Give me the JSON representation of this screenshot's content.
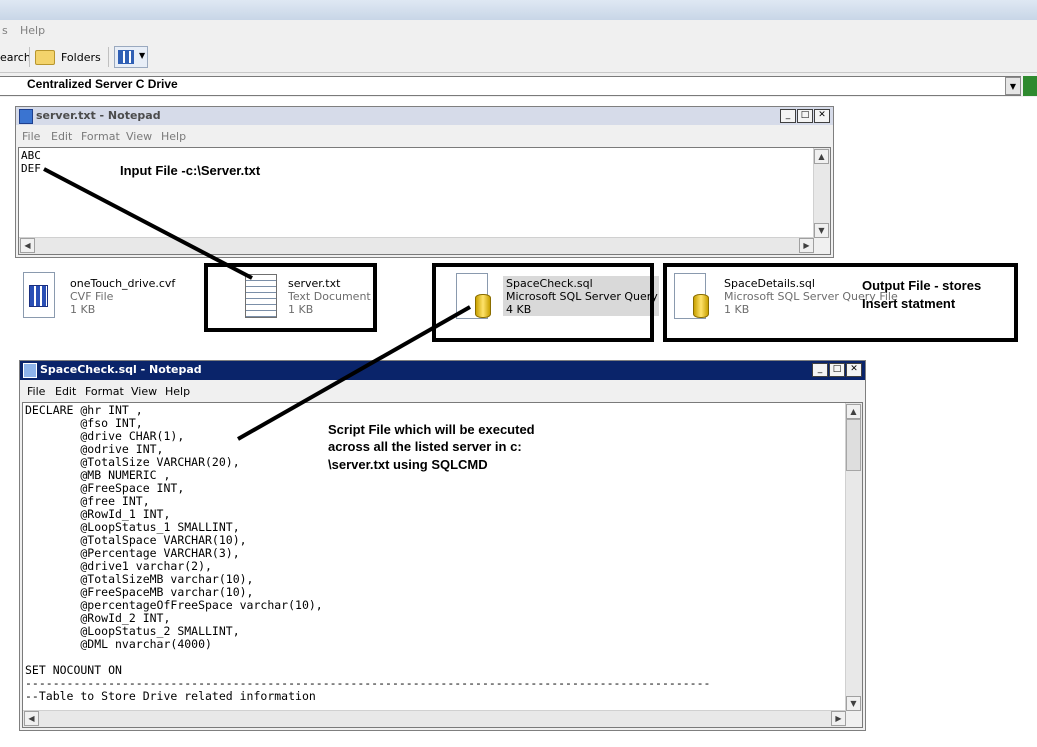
{
  "explorer": {
    "menu": {
      "help": "Help"
    },
    "toolbar": {
      "search": "earch",
      "folders": "Folders"
    },
    "address": "Centralized Server C Drive"
  },
  "server_notepad": {
    "title": "server.txt - Notepad",
    "menu": [
      "File",
      "Edit",
      "Format",
      "View",
      "Help"
    ],
    "lines": [
      "ABC",
      "DEF"
    ]
  },
  "files": [
    {
      "name": "oneTouch_drive.cvf",
      "type": "CVF File",
      "size": "1 KB",
      "icon": "cvf-file-icon"
    },
    {
      "name": "server.txt",
      "type": "Text Document",
      "size": "1 KB",
      "icon": "text-document-icon"
    },
    {
      "name": "SpaceCheck.sql",
      "type": "Microsoft SQL Server Query File",
      "size": "4 KB",
      "icon": "sql-file-icon"
    },
    {
      "name": "SpaceDetails.sql",
      "type": "Microsoft SQL Server Query File",
      "size": "1 KB",
      "icon": "sql-file-icon"
    }
  ],
  "annotations": {
    "input": "Input File -c:\\Server.txt",
    "output_1": "Output File - stores",
    "output_2": "Insert statment",
    "script_1": "Script File which will be executed",
    "script_2": "across all the listed server in c:",
    "script_3": "\\server.txt using SQLCMD"
  },
  "spacecheck_notepad": {
    "title": "SpaceCheck.sql - Notepad",
    "menu": [
      "File",
      "Edit",
      "Format",
      "View",
      "Help"
    ],
    "code": "DECLARE @hr INT ,\n        @fso INT,\n        @drive CHAR(1),\n        @odrive INT,\n        @TotalSize VARCHAR(20),\n        @MB NUMERIC ,\n        @FreeSpace INT,\n        @free INT,\n        @RowId_1 INT,\n        @LoopStatus_1 SMALLINT,\n        @TotalSpace VARCHAR(10),\n        @Percentage VARCHAR(3),\n        @drive1 varchar(2),\n        @TotalSizeMB varchar(10),\n        @FreeSpaceMB varchar(10),\n        @percentageOfFreeSpace varchar(10),\n        @RowId_2 INT,\n        @LoopStatus_2 SMALLINT,\n        @DML nvarchar(4000)\n\nSET NOCOUNT ON\n---------------------------------------------------------------------------------------------------\n--Table to Store Drive related information"
  },
  "colors": {
    "active_title": "#0a246a",
    "inactive_title": "#d6dbe9",
    "selection": "#d9d9d9"
  }
}
